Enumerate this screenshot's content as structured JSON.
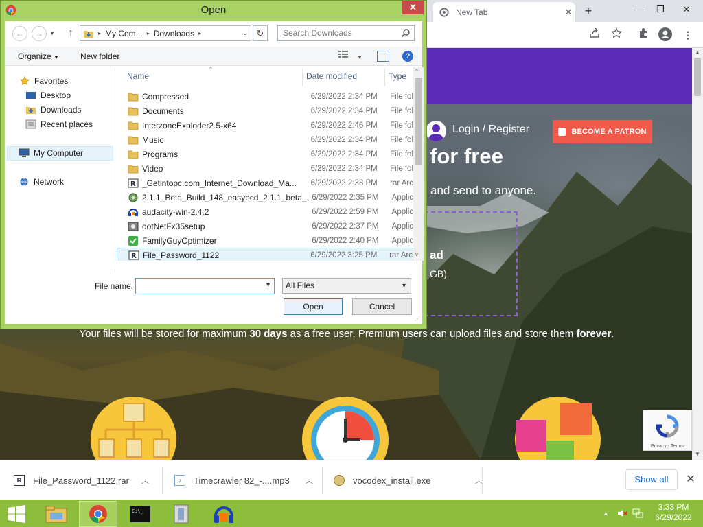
{
  "browser": {
    "tab_title": "New Tab",
    "tab_close": "✕",
    "new_tab": "+",
    "window_controls": [
      "—",
      "❐",
      "✕"
    ],
    "toolbar_icons": [
      "share-icon",
      "bookmark-star-icon",
      "extensions-icon",
      "profile-icon",
      "menu-icon"
    ]
  },
  "website": {
    "login_label": "Login / Register",
    "patron_button": "BECOME A PATRON",
    "hero_title_fragment": "for free",
    "hero_subtitle_fragment": "and send to anyone.",
    "upload_title_fragment": "ad",
    "upload_sub_fragment": "GB)",
    "storage_note": {
      "prefix": "Your files will be stored for maximum ",
      "days": "30 days",
      "middle": " as a free user. Premium users can upload files and store them ",
      "forever": "forever",
      "suffix": "."
    },
    "recaptcha_text": "Privacy - Terms",
    "accent_color": "#5b2bb5",
    "patron_color": "#f15a4a"
  },
  "dialog": {
    "title": "Open",
    "close": "✕",
    "breadcrumb": [
      "My Com...",
      "Downloads"
    ],
    "search_placeholder": "Search Downloads",
    "organize": "Organize",
    "new_folder": "New folder",
    "help": "?",
    "nav": {
      "favorites": "Favorites",
      "desktop": "Desktop",
      "downloads": "Downloads",
      "recent": "Recent places",
      "my_computer": "My Computer",
      "network": "Network"
    },
    "columns": [
      "Name",
      "Date modified",
      "Type"
    ],
    "files": [
      {
        "name": "Compressed",
        "date": "6/29/2022 2:34 PM",
        "type": "File fol",
        "icon": "folder-icon"
      },
      {
        "name": "Documents",
        "date": "6/29/2022 2:34 PM",
        "type": "File fol",
        "icon": "folder-icon"
      },
      {
        "name": "InterzoneExploder2.5-x64",
        "date": "6/29/2022 2:46 PM",
        "type": "File fol",
        "icon": "folder-icon"
      },
      {
        "name": "Music",
        "date": "6/29/2022 2:34 PM",
        "type": "File fol",
        "icon": "folder-icon"
      },
      {
        "name": "Programs",
        "date": "6/29/2022 2:34 PM",
        "type": "File fol",
        "icon": "folder-icon"
      },
      {
        "name": "Video",
        "date": "6/29/2022 2:34 PM",
        "type": "File fol",
        "icon": "folder-icon"
      },
      {
        "name": "_Getintopc.com_Internet_Download_Ma...",
        "date": "6/29/2022 2:33 PM",
        "type": "rar Arc",
        "icon": "rar-archive-icon"
      },
      {
        "name": "2.1.1_Beta_Build_148_easybcd_2.1.1_beta_...",
        "date": "6/29/2022 2:35 PM",
        "type": "Applic",
        "icon": "installer-icon"
      },
      {
        "name": "audacity-win-2.4.2",
        "date": "6/29/2022 2:59 PM",
        "type": "Applic",
        "icon": "audacity-icon"
      },
      {
        "name": "dotNetFx35setup",
        "date": "6/29/2022 2:37 PM",
        "type": "Applic",
        "icon": "setup-icon"
      },
      {
        "name": "FamilyGuyOptimizer",
        "date": "6/29/2022 2:40 PM",
        "type": "Applic",
        "icon": "checkmark-app-icon"
      },
      {
        "name": "File_Password_1122",
        "date": "6/29/2022 3:25 PM",
        "type": "rar Arc",
        "icon": "rar-archive-icon",
        "selected": true
      }
    ],
    "file_name_label": "File name:",
    "file_name_value": "",
    "file_type": "All Files",
    "open_button": "Open",
    "cancel_button": "Cancel"
  },
  "downloads": [
    {
      "name": "File_Password_1122.rar",
      "icon": "rar-archive-icon"
    },
    {
      "name": "Timecrawler 82_-....mp3",
      "icon": "audio-file-icon"
    },
    {
      "name": "vocodex_install.exe",
      "icon": "installer-icon"
    }
  ],
  "show_all": "Show all",
  "taskbar": {
    "time": "3:33 PM",
    "date": "6/29/2022",
    "apps": [
      "file-explorer-icon",
      "chrome-icon",
      "cmd-icon",
      "archive-icon",
      "audacity-icon"
    ]
  }
}
